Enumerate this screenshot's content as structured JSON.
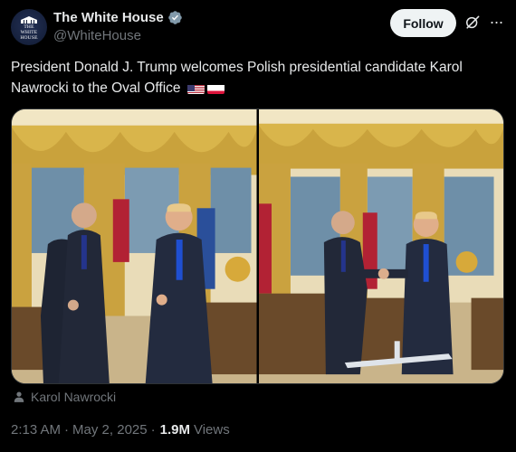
{
  "account": {
    "display_name": "The White House",
    "handle": "@WhiteHouse",
    "avatar_text": "THE WHITE HOUSE",
    "verified_color": "#829aab"
  },
  "actions": {
    "follow_label": "Follow",
    "grok_icon": "grok-icon",
    "more_icon": "more-icon"
  },
  "tweet": {
    "text": "President Donald J. Trump welcomes Polish presidential candidate Karol Nawrocki to the Oval Office",
    "flags": [
      "us-flag",
      "poland-flag"
    ]
  },
  "media": {
    "photo_count": 2,
    "tagged_person": "Karol Nawrocki"
  },
  "meta": {
    "time": "2:13 AM",
    "separator": "·",
    "date": "May 2, 2025",
    "views_count": "1.9M",
    "views_label": "Views"
  },
  "colors": {
    "background": "#000000",
    "text_primary": "#e7e9ea",
    "text_secondary": "#71767b",
    "follow_bg": "#eff3f4"
  }
}
